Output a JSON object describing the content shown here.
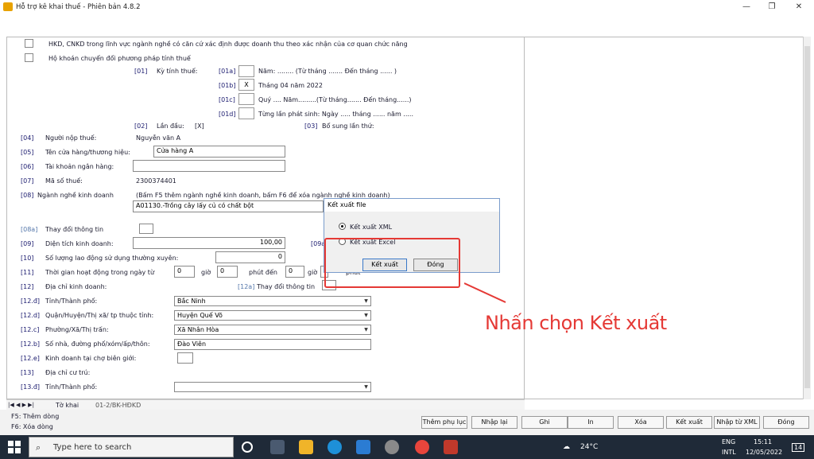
{
  "window": {
    "title": "Hỗ trợ kê khai thuế - Phiên bản 4.8.2",
    "minimize": "—",
    "maximize": "❐",
    "close": "✕"
  },
  "form": {
    "row_hkd": "HKD, CNKD trong lĩnh vực ngành nghề có căn cứ xác định được doanh thu theo xác nhận của cơ quan chức năng",
    "row_hokhoan": "Hộ khoán chuyển đổi phương pháp tính thuế",
    "ky_tinh_thue_code": "[01]",
    "ky_tinh_thue_label": "Kỳ tính thuế:",
    "p01a_code": "[01a]",
    "p01a_text": "Năm: ........ (Từ tháng ....... Đến tháng ...... )",
    "p01b_code": "[01b]",
    "p01b_mark": "X",
    "p01b_text": "Tháng 04 năm 2022",
    "p01c_code": "[01c]",
    "p01c_text": "Quý .... Năm.........(Từ tháng....... Đến tháng......)",
    "p01d_code": "[01d]",
    "p01d_text": "Từng lần phát sinh: Ngày ..... tháng ...... năm .....",
    "lan_dau_code": "[02]",
    "lan_dau_label": "Lần đầu:",
    "lan_dau_value": "[X]",
    "bo_sung_code": "[03]",
    "bo_sung_label": "Bổ sung lần thứ:",
    "nguoi_nop_code": "[04]",
    "nguoi_nop_label": "Người nộp thuế:",
    "nguoi_nop_value": "Nguyễn văn A",
    "ten_ch_code": "[05]",
    "ten_ch_label": "Tên cửa hàng/thương hiệu:",
    "ten_ch_value": "Cửa hàng A",
    "tk_code": "[06]",
    "tk_label": "Tài khoản ngân hàng:",
    "tk_value": "",
    "mst_code": "[07]",
    "mst_label": "Mã số thuế:",
    "mst_value": "2300374401",
    "nganh_code": "[08]",
    "nganh_label": "Ngành nghề kinh doanh",
    "nganh_hint": "(Bấm F5 thêm ngành nghề kinh doanh, bấm F6 để xóa ngành nghề kinh doanh)",
    "nganh_value": "A01130.-Trồng cây lấy củ có chất bột",
    "thaydoi_code": "[08a]",
    "thaydoi_label": "Thay đổi thông tin",
    "dientich_code": "[09]",
    "dientich_label": "Diện tích kinh doanh:",
    "dientich_value": "100,00",
    "p09a_code": "[09a]",
    "laodong_code": "[10]",
    "laodong_label": "Số lượng lao động sử dụng thường xuyên:",
    "laodong_value": "0",
    "thoigian_code": "[11]",
    "thoigian_label": "Thời gian hoạt động trong ngày từ",
    "tg_from": "0",
    "gio1": "giờ",
    "tg_from_m": "0",
    "phut_den": "phút đến",
    "tg_to": "0",
    "gio2": "giờ",
    "phut": "phút",
    "diachi_code": "[12]",
    "diachi_label": "Địa chỉ kinh doanh:",
    "p12a_code": "[12a]",
    "p12a_label": "Thay đổi thông tin",
    "tinh_code": "[12.đ]",
    "tinh_label": "Tỉnh/Thành phố:",
    "tinh_value": "Bắc Ninh",
    "quan_code": "[12.d]",
    "quan_label": "Quận/Huyện/Thị xã/ tp thuộc tỉnh:",
    "quan_value": "Huyện Quế Võ",
    "phuong_code": "[12.c]",
    "phuong_label": "Phường/Xã/Thị trấn:",
    "phuong_value": "Xã Nhân Hòa",
    "sonha_code": "[12.b]",
    "sonha_label": "Số nhà, đường phố/xóm/ấp/thôn:",
    "sonha_value": "Đào Viên",
    "bien_code": "[12.e]",
    "bien_label": "Kinh doanh tại chợ biên giới:",
    "cutru_code": "[13]",
    "cutru_label": "Địa chỉ cư trú:",
    "tinh2_code": "[13.đ]",
    "tinh2_label": "Tỉnh/Thành phố:",
    "tinh2_value": ""
  },
  "tabs": {
    "nav": "|◀ ◀ ▶ ▶|",
    "tab1": "Tờ khai",
    "tab2": "01-2/BK-HĐKD"
  },
  "hints": {
    "f5": "F5: Thêm dòng",
    "f6": "F6: Xóa dòng"
  },
  "buttons": {
    "them_phu_luc": "Thêm phụ lục",
    "nhap_lai": "Nhập lại",
    "ghi": "Ghi",
    "in": "In",
    "xoa": "Xóa",
    "ket_xuat": "Kết xuất",
    "nhap_xml": "Nhập từ XML",
    "dong": "Đóng"
  },
  "dialog": {
    "title": "Kết xuất file",
    "opt_xml": "Kết xuất XML",
    "opt_excel": "Kết xuất Excel",
    "ok": "Kết xuất",
    "close": "Đóng"
  },
  "callout": "Nhấn chọn Kết xuất",
  "taskbar": {
    "search_placeholder": "Type here to search",
    "temp": "24°C",
    "lang1": "ENG",
    "lang2": "INTL",
    "time": "15:11",
    "date": "12/05/2022",
    "notif": "14"
  },
  "colors": {
    "accent_red": "#e53935",
    "taskbar": "#1f2a38",
    "code_blue": "#1a1a6e"
  }
}
